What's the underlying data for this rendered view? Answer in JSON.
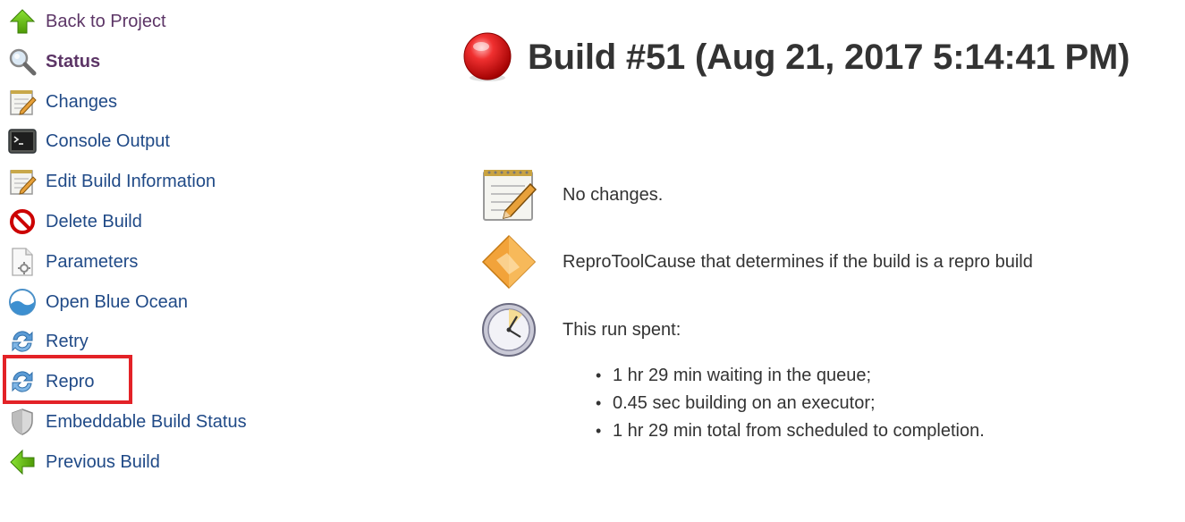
{
  "sidebar": {
    "items": [
      {
        "label": "Back to Project",
        "icon": "up-arrow-icon"
      },
      {
        "label": "Status",
        "icon": "magnifier-icon"
      },
      {
        "label": "Changes",
        "icon": "notepad-icon"
      },
      {
        "label": "Console Output",
        "icon": "terminal-icon"
      },
      {
        "label": "Edit Build Information",
        "icon": "notepad-icon"
      },
      {
        "label": "Delete Build",
        "icon": "no-entry-icon"
      },
      {
        "label": "Parameters",
        "icon": "document-gear-icon"
      },
      {
        "label": "Open Blue Ocean",
        "icon": "blue-ocean-icon"
      },
      {
        "label": "Retry",
        "icon": "refresh-icon"
      },
      {
        "label": "Repro",
        "icon": "refresh-icon"
      },
      {
        "label": "Embeddable Build Status",
        "icon": "shield-icon"
      },
      {
        "label": "Previous Build",
        "icon": "left-arrow-icon"
      }
    ]
  },
  "main": {
    "title": "Build #51 (Aug 21, 2017 5:14:41 PM)",
    "status_color": "#e82020",
    "changes_text": "No changes.",
    "cause_text": "ReproToolCause that determines if the build is a repro build",
    "timing_heading": "This run spent:",
    "timing": [
      "1 hr 29 min waiting in the queue;",
      "0.45 sec building on an executor;",
      "1 hr 29 min total from scheduled to completion."
    ]
  },
  "colors": {
    "link": "#204a87",
    "visited": "#5c3566",
    "highlight": "#e32227"
  }
}
